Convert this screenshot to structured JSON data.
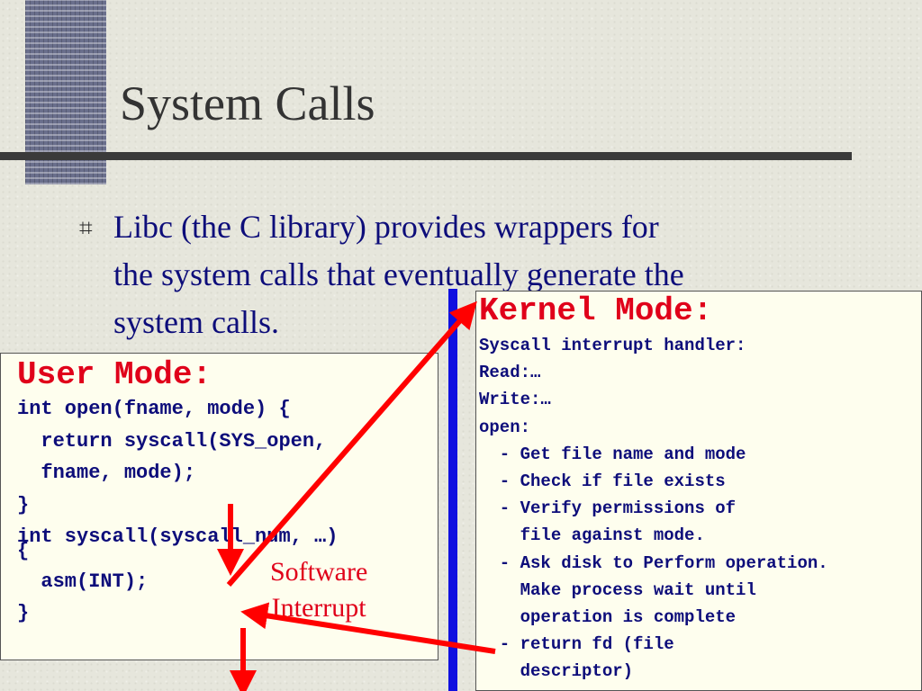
{
  "slide": {
    "title": "System Calls",
    "bullet_glyph": "⌗",
    "bullet_lines": [
      "Libc (the C library) provides wrappers for",
      "the system calls that eventually generate the",
      "system calls."
    ]
  },
  "user_mode": {
    "title": "User Mode:",
    "lines": [
      "int open(fname, mode) {",
      "  return syscall(SYS_open,",
      "  fname, mode);",
      "}",
      "int syscall(syscall_num, …)",
      "{",
      "  asm(INT);",
      "}"
    ]
  },
  "kernel_mode": {
    "title": "Kernel Mode:",
    "lines": [
      "Syscall interrupt handler:",
      "Read:…",
      "Write:…",
      "open:",
      "  - Get file name and mode",
      "  - Check if file exists",
      "  - Verify permissions of",
      "    file against mode.",
      "  - Ask disk to Perform operation.",
      "    Make process wait until",
      "    operation is complete",
      "  - return fd (file",
      "    descriptor)"
    ]
  },
  "annotation": {
    "lines": [
      "Software",
      "Interrupt"
    ]
  },
  "colors": {
    "title_text": "#333333",
    "body_text": "#0d0d7a",
    "mode_title": "#e0001a",
    "arrow": "#ff0000",
    "divider": "#1010e0"
  }
}
